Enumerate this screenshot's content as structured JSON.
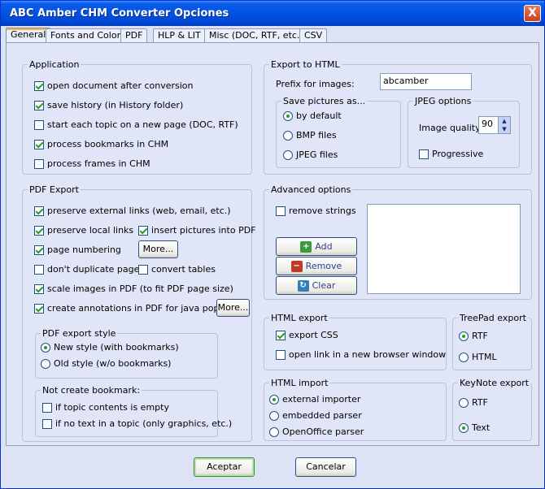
{
  "window": {
    "title": "ABC Amber CHM Converter Opciones",
    "close_label": "X"
  },
  "tabs": [
    "General",
    "Fonts and Colors",
    "PDF",
    "HLP & LIT",
    "Misc (DOC, RTF, etc.)",
    "CSV"
  ],
  "application": {
    "title": "Application",
    "items": [
      {
        "label": "open document after conversion",
        "checked": true
      },
      {
        "label": "save history (in History folder)",
        "checked": true
      },
      {
        "label": "start each topic on a new page (DOC, RTF)",
        "checked": false
      },
      {
        "label": "process bookmarks in CHM",
        "checked": true
      },
      {
        "label": "process frames in CHM",
        "checked": false
      }
    ]
  },
  "pdf_export": {
    "title": "PDF Export",
    "preserve_external": "preserve external links (web, email, etc.)",
    "preserve_local": "preserve local links",
    "insert_pictures": "insert pictures into PDF",
    "page_numbering": "page numbering",
    "more1": "More...",
    "dont_duplicate": "don't duplicate pages",
    "convert_tables": "convert tables",
    "scale_images": "scale images in PDF (to fit PDF page size)",
    "create_annotations": "create annotations in PDF for java pop-ups",
    "more2": "More...",
    "style_title": "PDF export style",
    "new_style": "New style (with bookmarks)",
    "old_style": "Old style (w/o bookmarks)",
    "not_create_title": "Not create bookmark:",
    "if_empty": "if topic contents is empty",
    "if_no_text": "if no text in a topic (only graphics, etc.)"
  },
  "export_html": {
    "title": "Export to HTML",
    "prefix_label": "Prefix for images:",
    "prefix_value": "abcamber",
    "save_pictures_title": "Save pictures as...",
    "by_default": "by default",
    "bmp_files": "BMP files",
    "jpeg_files": "JPEG files",
    "jpeg_options_title": "JPEG options",
    "image_quality_label": "Image quality:",
    "image_quality_value": "90",
    "progressive": "Progressive"
  },
  "advanced": {
    "title": "Advanced options",
    "remove_strings": "remove strings",
    "add": "Add",
    "remove": "Remove",
    "clear": "Clear"
  },
  "html_export": {
    "title": "HTML export",
    "export_css": "export CSS",
    "open_link": "open link in a new browser window"
  },
  "treepad": {
    "title": "TreePad export",
    "rtf": "RTF",
    "html": "HTML"
  },
  "html_import": {
    "title": "HTML import",
    "external": "external importer",
    "embedded": "embedded parser",
    "openoffice": "OpenOffice parser"
  },
  "keynote": {
    "title": "KeyNote export",
    "rtf": "RTF",
    "text": "Text"
  },
  "footer": {
    "accept": "Aceptar",
    "cancel": "Cancelar"
  }
}
